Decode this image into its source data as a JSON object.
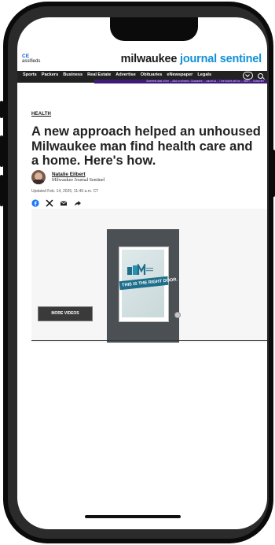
{
  "header": {
    "left_crop_top": "CE",
    "left_crop_bottom": "assifieds",
    "brand_part1": "milwaukee",
    "brand_part2": "journal sentinel"
  },
  "nav": {
    "items": [
      "Sports",
      "Packers",
      "Business",
      "Real Estate",
      "Advertise",
      "Obituaries",
      "eNewspaper",
      "Legals"
    ],
    "promo": "Sweetest deal of the ... Add-on dinners. Guarantee ... cancel at ... / the tickets sell for ... NMH ... Subscribe"
  },
  "article": {
    "section": "HEALTH",
    "headline": "A new approach helped an unhoused Milwaukee man find health care and a home. Here's how.",
    "author": "Natalie Eilbert",
    "outlet": "Milwaukee Journal Sentinel",
    "updated": "Updated Feb. 14, 2025, 11:49 a.m. CT"
  },
  "share": {
    "icons": [
      "facebook-icon",
      "x-icon",
      "email-icon",
      "share-arrow-icon"
    ]
  },
  "video": {
    "sign_text": "THIS IS THE RIGHT DOOR.",
    "more_videos": "MORE VIDEOS"
  },
  "colors": {
    "brand_blue": "#1190d8",
    "nav_bg": "#222222",
    "promo_bg": "#3e1b78"
  }
}
